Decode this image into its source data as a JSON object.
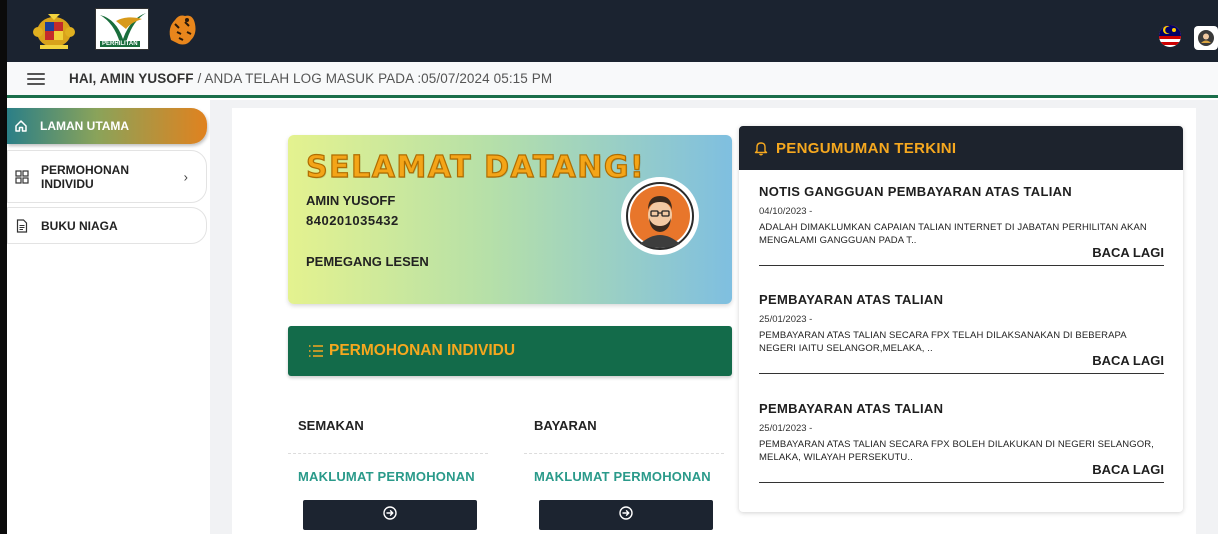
{
  "header": {
    "logo_text": "PERHILITAN",
    "icons": [
      "crest-logo",
      "perhilitan-logo",
      "tiger-logo",
      "malaysia-flag-icon",
      "profile-icon"
    ]
  },
  "greeting": {
    "name": "HAI, AMIN YUSOFF",
    "login_info": " / ANDA TELAH LOG MASUK PADA :05/07/2024 05:15 PM"
  },
  "sidebar": {
    "items": [
      {
        "label": "LAMAN UTAMA",
        "icon": "home-icon"
      },
      {
        "label_line1": "PERMOHONAN",
        "label_line2": "INDIVIDU",
        "icon": "grid-icon"
      },
      {
        "label": "BUKU NIAGA",
        "icon": "document-icon"
      }
    ]
  },
  "welcome": {
    "title": "SELAMAT DATANG!",
    "name": "AMIN YUSOFF",
    "ic_number": "840201035432",
    "role": "PEMEGANG LESEN"
  },
  "permohonan": {
    "title": "PERMOHONAN INDIVIDU",
    "columns": [
      {
        "heading": "SEMAKAN",
        "link": "MAKLUMAT PERMOHONAN"
      },
      {
        "heading": "BAYARAN",
        "link": "MAKLUMAT PERMOHONAN"
      }
    ]
  },
  "announcements": {
    "title": "PENGUMUMAN TERKINI",
    "read_more": "BACA LAGI",
    "items": [
      {
        "title": "NOTIS GANGGUAN PEMBAYARAN ATAS TALIAN",
        "date": "04/10/2023 -",
        "body": "ADALAH DIMAKLUMKAN CAPAIAN TALIAN INTERNET DI JABATAN PERHILITAN AKAN MENGALAMI GANGGUAN PADA T.."
      },
      {
        "title": "PEMBAYARAN ATAS TALIAN",
        "date": "25/01/2023 -",
        "body": "PEMBAYARAN ATAS TALIAN SECARA FPX TELAH DILAKSANAKAN DI BEBERAPA NEGERI IAITU SELANGOR,MELAKA, .."
      },
      {
        "title": "PEMBAYARAN ATAS TALIAN",
        "date": "25/01/2023 -",
        "body": "PEMBAYARAN ATAS TALIAN SECARA FPX BOLEH DILAKUKAN DI NEGERI SELANGOR, MELAKA, WILAYAH PERSEKUTU.."
      }
    ]
  },
  "colors": {
    "header_bg": "#1b2330",
    "accent_orange": "#f6a81f",
    "green": "#136b4a",
    "link_teal": "#2a9a8a"
  }
}
